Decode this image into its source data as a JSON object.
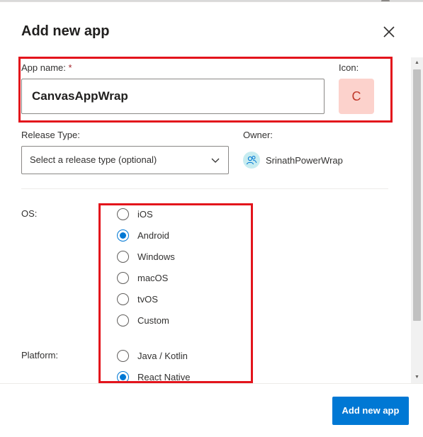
{
  "dialog": {
    "title": "Add new app",
    "close_icon": "close-icon"
  },
  "form": {
    "app_name_label": "App name:",
    "required_marker": "*",
    "app_name_value": "CanvasAppWrap",
    "icon_label": "Icon:",
    "icon_letter": "C",
    "release_type_label": "Release Type:",
    "release_type_placeholder": "Select a release type (optional)",
    "owner_label": "Owner:",
    "owner_name": "SrinathPowerWrap",
    "os_label": "OS:",
    "os_options": [
      {
        "label": "iOS",
        "checked": false
      },
      {
        "label": "Android",
        "checked": true
      },
      {
        "label": "Windows",
        "checked": false
      },
      {
        "label": "macOS",
        "checked": false
      },
      {
        "label": "tvOS",
        "checked": false
      },
      {
        "label": "Custom",
        "checked": false
      }
    ],
    "platform_label": "Platform:",
    "platform_options": [
      {
        "label": "Java / Kotlin",
        "checked": false
      },
      {
        "label": "React Native",
        "checked": true
      }
    ]
  },
  "footer": {
    "submit_label": "Add new app"
  },
  "colors": {
    "accent": "#0078d4",
    "highlight": "#e3141c",
    "icon_bg": "#fcd2cc",
    "icon_fg": "#c0392b"
  }
}
